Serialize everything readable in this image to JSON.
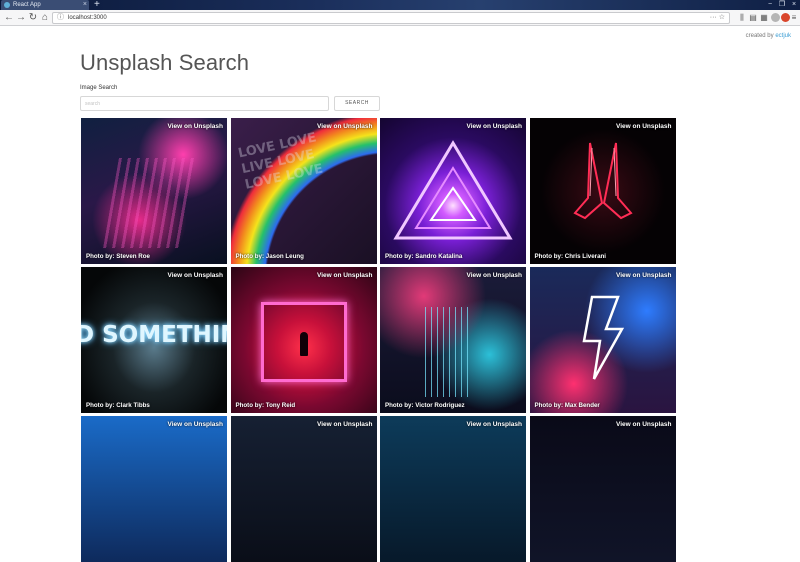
{
  "browser": {
    "tab_title": "React App",
    "tab_close": "×",
    "new_tab": "+",
    "url": "localhost:3000",
    "window_controls": [
      "−",
      "❐",
      "×"
    ],
    "url_actions": "··· ☆"
  },
  "credit": {
    "prefix": "created by ",
    "link": "ectjuk"
  },
  "page": {
    "title": "Unsplash Search",
    "search_label": "Image Search",
    "search_placeholder": "search",
    "search_value": "",
    "search_button": "SEARCH"
  },
  "photos": [
    {
      "link": "View on Unsplash",
      "prefix": "Photo by: ",
      "author": "Steven Roe"
    },
    {
      "link": "View on Unsplash",
      "prefix": "Photo by: ",
      "author": "Jason Leung"
    },
    {
      "link": "View on Unsplash",
      "prefix": "Photo by: ",
      "author": "Sandro Katalina"
    },
    {
      "link": "View on Unsplash",
      "prefix": "Photo by: ",
      "author": "Chris Liverani"
    },
    {
      "link": "View on Unsplash",
      "prefix": "Photo by: ",
      "author": "Clark Tibbs"
    },
    {
      "link": "View on Unsplash",
      "prefix": "Photo by: ",
      "author": "Tony Reid"
    },
    {
      "link": "View on Unsplash",
      "prefix": "Photo by: ",
      "author": "Victor Rodriguez"
    },
    {
      "link": "View on Unsplash",
      "prefix": "Photo by: ",
      "author": "Max Bender"
    },
    {
      "link": "View on Unsplash"
    },
    {
      "link": "View on Unsplash"
    },
    {
      "link": "View on Unsplash"
    },
    {
      "link": "View on Unsplash"
    }
  ],
  "photo_art": [
    {
      "kind": "city"
    },
    {
      "kind": "rainbow"
    },
    {
      "kind": "triangle"
    },
    {
      "kind": "hands"
    },
    {
      "kind": "sign"
    },
    {
      "kind": "corridor"
    },
    {
      "kind": "tower"
    },
    {
      "kind": "bolt"
    },
    {
      "kind": "blue"
    },
    {
      "kind": "dark"
    },
    {
      "kind": "teal"
    },
    {
      "kind": "night"
    }
  ]
}
